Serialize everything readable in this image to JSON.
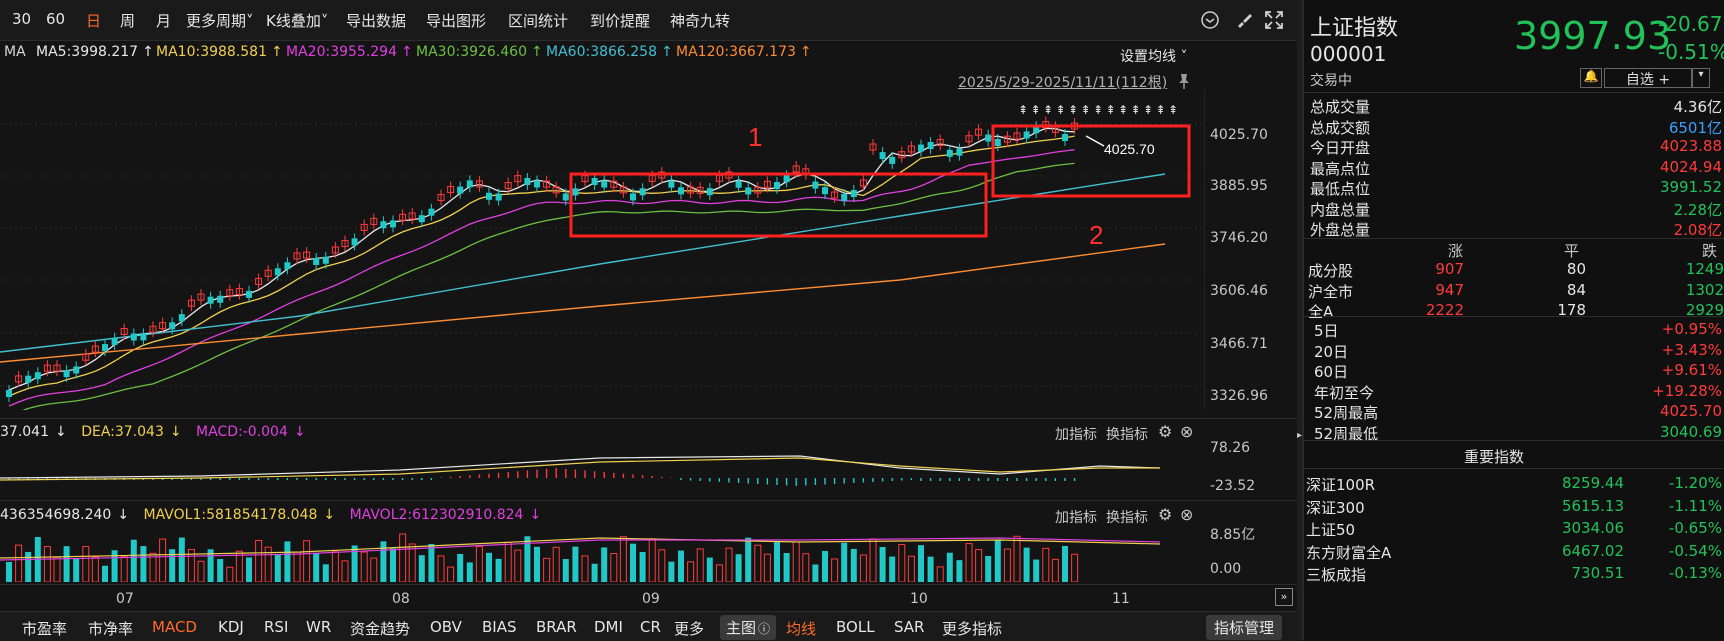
{
  "toolbar": {
    "items": [
      "30",
      "60",
      "日",
      "周",
      "月",
      "更多周期",
      "K线叠加",
      "导出数据",
      "导出图形",
      "区间统计",
      "到价提醒",
      "神奇九转"
    ],
    "active_index": 2
  },
  "ma_line": {
    "label": "MA",
    "ma5": "MA5:3998.217",
    "ma10": "MA10:3988.581",
    "ma20": "MA20:3955.294",
    "ma30": "MA30:3926.460",
    "ma60": "MA60:3866.258",
    "ma120": "MA120:3667.173",
    "arrow": "↑",
    "set_ma": "设置均线"
  },
  "range_info": "2025/5/29-2025/11/11(112根)",
  "price_axis": [
    "4025.70",
    "3885.95",
    "3746.20",
    "3606.46",
    "3466.71",
    "3326.96"
  ],
  "annotations": {
    "box1": "1",
    "box2": "2",
    "high_marker": "4025.70"
  },
  "macd": {
    "dif": "37.041",
    "dea": "DEA:37.043",
    "macd": "MACD:-0.004",
    "arrow": "↓",
    "axis_top": "78.26",
    "axis_bottom": "-23.52"
  },
  "vol": {
    "vol": "436354698.240",
    "mavol1": "MAVOL1:581854178.048",
    "mavol2": "MAVOL2:612302910.824",
    "arrow": "↓",
    "axis_top": "8.85亿",
    "axis_bottom": "0.00"
  },
  "indicator_buttons": {
    "add": "加指标",
    "switch": "换指标"
  },
  "months": [
    "07",
    "08",
    "09",
    "10",
    "11"
  ],
  "bottom_bar": [
    "市盈率",
    "市净率",
    "MACD",
    "KDJ",
    "RSI",
    "WR",
    "资金趋势",
    "OBV",
    "BIAS",
    "BRAR",
    "DMI",
    "CR",
    "更多",
    "主图",
    "均线",
    "BOLL",
    "SAR",
    "更多指标",
    "指标管理"
  ],
  "quote": {
    "name": "上证指数",
    "code": "000001",
    "price": "3997.93",
    "change": "-20.67",
    "change_pct": "-0.51%",
    "status": "交易中",
    "watchlist": "自选",
    "plus": "+"
  },
  "stats": [
    {
      "label": "总成交量",
      "value": "4.36亿",
      "color": "white"
    },
    {
      "label": "总成交额",
      "value": "6501亿",
      "color": "blue"
    },
    {
      "label": "今日开盘",
      "value": "4023.88",
      "color": "red"
    },
    {
      "label": "最高点位",
      "value": "4024.94",
      "color": "red"
    },
    {
      "label": "最低点位",
      "value": "3991.52",
      "color": "green"
    },
    {
      "label": "内盘总量",
      "value": "2.28亿",
      "color": "green"
    },
    {
      "label": "外盘总量",
      "value": "2.08亿",
      "color": "red"
    }
  ],
  "breadth": {
    "headers": [
      "涨",
      "平",
      "跌"
    ],
    "rows": [
      {
        "label": "成分股",
        "up": "907",
        "flat": "80",
        "down": "1249"
      },
      {
        "label": "沪全市",
        "up": "947",
        "flat": "84",
        "down": "1302"
      },
      {
        "label": "全A",
        "up": "2222",
        "flat": "178",
        "down": "2929"
      }
    ]
  },
  "periods": [
    {
      "label": "5日",
      "value": "+0.95%",
      "color": "red"
    },
    {
      "label": "20日",
      "value": "+3.43%",
      "color": "red"
    },
    {
      "label": "60日",
      "value": "+9.61%",
      "color": "red"
    },
    {
      "label": "年初至今",
      "value": "+19.28%",
      "color": "red"
    },
    {
      "label": "52周最高",
      "value": "4025.70",
      "color": "red"
    },
    {
      "label": "52周最低",
      "value": "3040.69",
      "color": "green"
    }
  ],
  "indices_title": "重要指数",
  "indices": [
    {
      "name": "深证100R",
      "price": "8259.44",
      "pct": "-1.20%"
    },
    {
      "name": "深证300",
      "price": "5615.13",
      "pct": "-1.11%"
    },
    {
      "name": "上证50",
      "price": "3034.06",
      "pct": "-0.65%"
    },
    {
      "name": "东方财富全A",
      "price": "6467.02",
      "pct": "-0.54%"
    },
    {
      "name": "三板成指",
      "price": "730.51",
      "pct": "-0.13%"
    }
  ],
  "colors": {
    "up": "#ff3b3b",
    "down": "#22c8c8",
    "price_green": "#22c25a",
    "active": "#ff6a2a",
    "box": "#ff2020"
  }
}
